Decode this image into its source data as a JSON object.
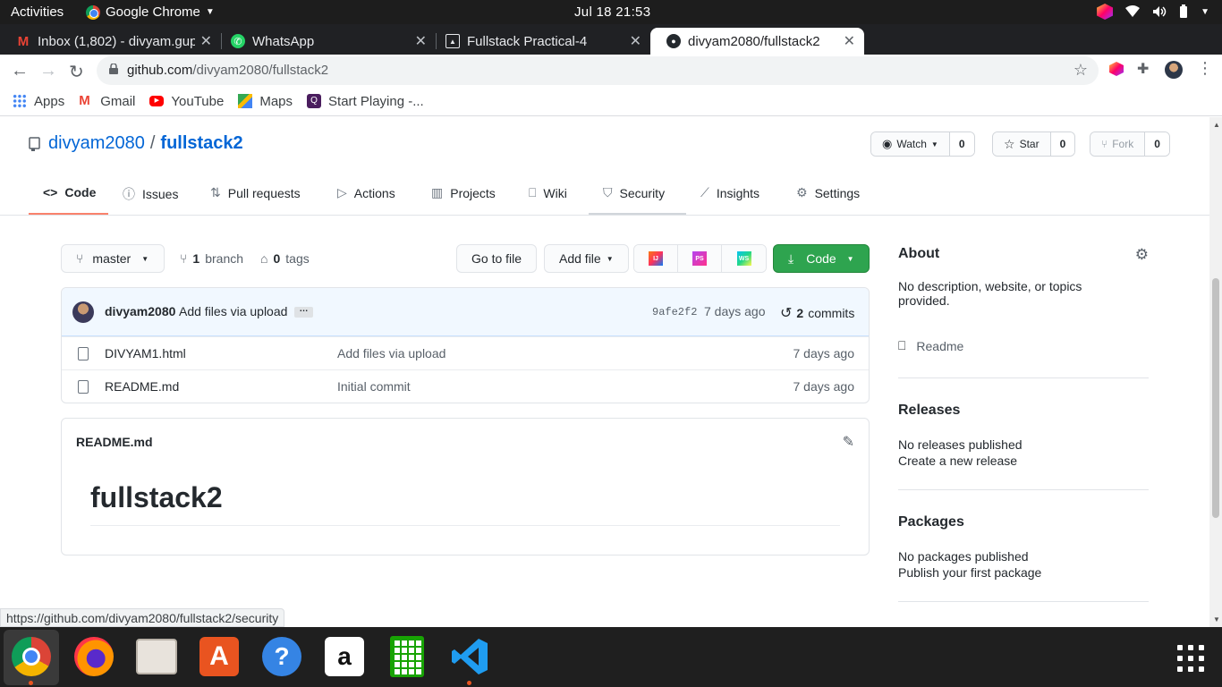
{
  "system": {
    "activities": "Activities",
    "app_name": "Google Chrome",
    "clock": "Jul 18  21:53"
  },
  "browser": {
    "tabs": [
      {
        "title": "Inbox (1,802) - divyam.gup",
        "icon": "gmail-icon"
      },
      {
        "title": "WhatsApp",
        "icon": "whatsapp-icon"
      },
      {
        "title": "Fullstack Practical-4",
        "icon": "document-icon"
      },
      {
        "title": "divyam2080/fullstack2",
        "icon": "github-icon",
        "active": true
      }
    ],
    "url_host": "github.com",
    "url_path": "/divyam2080/fullstack2",
    "bookmarks": [
      {
        "label": "Apps"
      },
      {
        "label": "Gmail"
      },
      {
        "label": "YouTube"
      },
      {
        "label": "Maps"
      },
      {
        "label": "Start Playing -..."
      }
    ],
    "status_url": "https://github.com/divyam2080/fullstack2/security"
  },
  "repo": {
    "owner": "divyam2080",
    "slash": "/",
    "name": "fullstack2",
    "watch": {
      "label": "Watch",
      "count": "0"
    },
    "star": {
      "label": "Star",
      "count": "0"
    },
    "fork": {
      "label": "Fork",
      "count": "0"
    },
    "nav": [
      {
        "label": "Code",
        "icon": "code-icon"
      },
      {
        "label": "Issues",
        "icon": "issue-icon"
      },
      {
        "label": "Pull requests",
        "icon": "pull-request-icon"
      },
      {
        "label": "Actions",
        "icon": "play-icon"
      },
      {
        "label": "Projects",
        "icon": "project-icon"
      },
      {
        "label": "Wiki",
        "icon": "book-icon"
      },
      {
        "label": "Security",
        "icon": "shield-icon"
      },
      {
        "label": "Insights",
        "icon": "graph-icon"
      },
      {
        "label": "Settings",
        "icon": "gear-icon"
      }
    ]
  },
  "filenav": {
    "branch": "master",
    "branch_count": "1",
    "branch_word": "branch",
    "tag_count": "0",
    "tag_word": "tags",
    "go_to_file": "Go to file",
    "add_file": "Add file",
    "code": "Code"
  },
  "commit": {
    "author": "divyam2080",
    "message": "Add files via upload",
    "ellipsis": "…",
    "sha": "9afe2f2",
    "time": "7 days ago",
    "count": "2",
    "count_word": "commits"
  },
  "files": [
    {
      "name": "DIVYAM1.html",
      "message": "Add files via upload",
      "age": "7 days ago"
    },
    {
      "name": "README.md",
      "message": "Initial commit",
      "age": "7 days ago"
    }
  ],
  "readme": {
    "title": "README.md",
    "heading": "fullstack2"
  },
  "sidebar": {
    "about": "About",
    "description": "No description, website, or topics provided.",
    "readme_link": "Readme",
    "releases": "Releases",
    "no_releases": "No releases published",
    "create_release": "Create a new release",
    "packages": "Packages",
    "no_packages": "No packages published",
    "publish_package": "Publish your first package"
  },
  "colors": {
    "link": "#0366d6",
    "green_button": "#2ea44f",
    "active_tab_underline": "#f9826c",
    "ubuntu_orange": "#e95420"
  }
}
